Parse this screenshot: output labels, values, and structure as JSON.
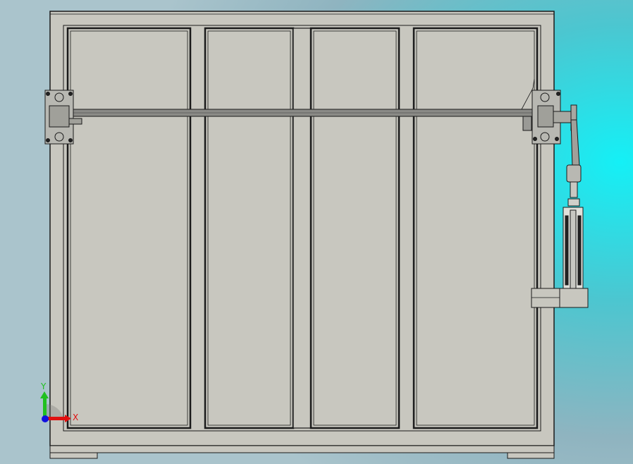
{
  "viewport": {
    "view": "front",
    "background_colors": [
      "#14f0f6",
      "#aac4cc"
    ]
  },
  "triad": {
    "x_label": "X",
    "y_label": "Y",
    "x_color": "#e01010",
    "y_color": "#20c020",
    "z_color": "#1010e0"
  },
  "model": {
    "body_color": "#c8c8c0",
    "edge_color": "#202020"
  }
}
